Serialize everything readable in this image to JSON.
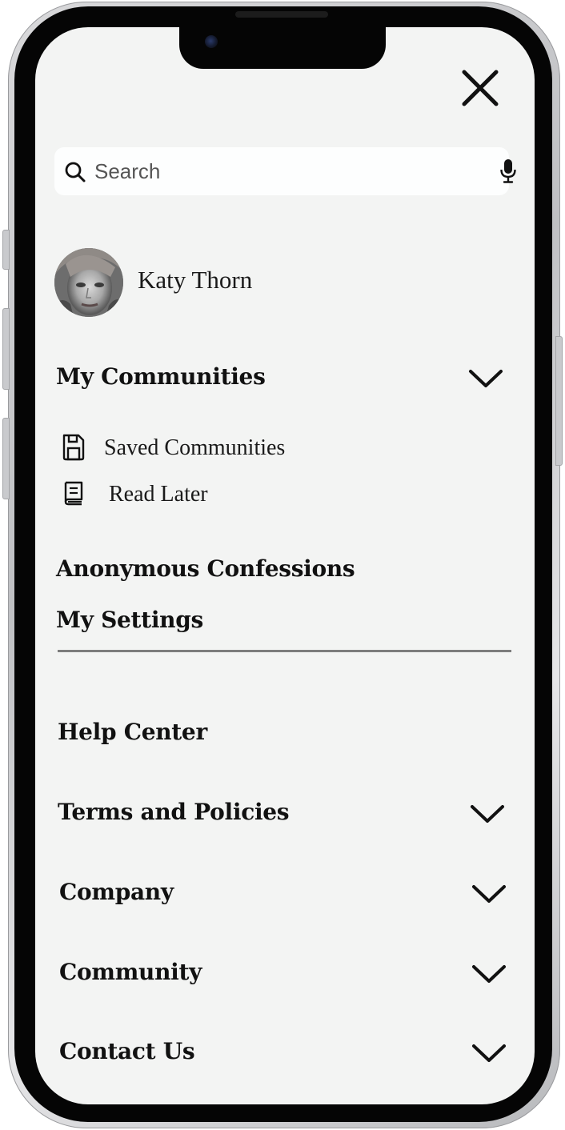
{
  "search": {
    "placeholder": "Search",
    "icon": "search-icon",
    "mic_icon": "microphone-icon"
  },
  "profile": {
    "name": "Katy Thorn"
  },
  "menu": {
    "my_communities": "My Communities",
    "sub_items": [
      {
        "label": "Saved Communities",
        "icon": "save-icon"
      },
      {
        "label": "Read Later",
        "icon": "book-icon"
      }
    ],
    "anonymous_confessions": "Anonymous Confessions",
    "my_settings": "My Settings",
    "help_center": "Help Center",
    "terms_and_policies": "Terms and Policies",
    "company": "Company",
    "community": "Community",
    "contact_us": "Contact Us"
  },
  "colors": {
    "screen_background": "#f3f4f3",
    "search_background": "#fdfefe",
    "text": "#111111",
    "divider": "#7d7d7d"
  }
}
